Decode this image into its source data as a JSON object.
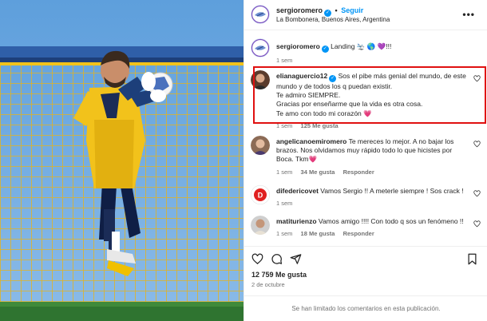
{
  "post": {
    "author": "sergioromero",
    "follow_label": "Seguir",
    "separator": "•",
    "location": "La Bombonera, Buenos Aires, Argentina",
    "caption": "Landing 🛬 🌎 💜!!!",
    "caption_time": "1 sem"
  },
  "highlight_color": "#e01010",
  "comments": [
    {
      "user": "elianaguercio12",
      "verified": true,
      "text_lines": [
        "Sos el pibe más genial del mundo, de este",
        "mundo y de todos los q puedan existir.",
        "Te admiro SIEMPRE.",
        "Gracias por enseñarme que la vida es otra cosa.",
        "Te amo con todo mi corazón 💗"
      ],
      "time": "1 sem",
      "likes": "125 Me gusta",
      "reply": ""
    },
    {
      "user": "angelicanoemiromero",
      "verified": false,
      "text_lines": [
        "Te mereces lo mejor. A no bajar los",
        "brazos. Nos olvidamos muy rápido todo lo que hicistes por",
        "Boca. Tkm💗"
      ],
      "time": "1 sem",
      "likes": "34 Me gusta",
      "reply": "Responder"
    },
    {
      "user": "difedericovet",
      "verified": false,
      "text_lines": [
        "Vamos Sergio !! A meterle siempre ! Sos crack !"
      ],
      "time": "1 sem",
      "likes": "",
      "reply": ""
    },
    {
      "user": "matiturienzo",
      "verified": false,
      "text_lines": [
        "Vamos amigo !!!! Con todo q sos un fenómeno !! "
      ],
      "time": "1 sem",
      "likes": "18 Me gusta",
      "reply": "Responder"
    }
  ],
  "actions": {
    "like_icon": "heart-icon",
    "comment_icon": "comment-icon",
    "share_icon": "share-icon",
    "save_icon": "bookmark-icon"
  },
  "likes_label": "12 759 Me gusta",
  "date_label": "2 de octubre",
  "limited_label": "Se han limitado los comentarios en esta publicación."
}
